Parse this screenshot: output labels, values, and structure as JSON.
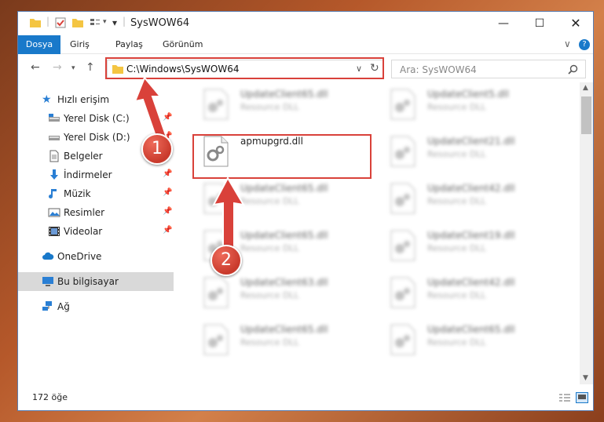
{
  "window": {
    "title": "SysWOW64"
  },
  "ribbon": {
    "tabs": [
      "Dosya",
      "Giriş",
      "Paylaş",
      "Görünüm"
    ]
  },
  "address": {
    "path": "C:\\Windows\\SysWOW64"
  },
  "search": {
    "placeholder": "Ara: SysWOW64"
  },
  "sidebar": {
    "quick_access": "Hızlı erişim",
    "items": [
      {
        "label": "Yerel Disk (C:)",
        "icon": "drive-icon"
      },
      {
        "label": "Yerel Disk (D:)",
        "icon": "drive-icon"
      },
      {
        "label": "Belgeler",
        "icon": "documents-icon"
      },
      {
        "label": "İndirmeler",
        "icon": "downloads-icon"
      },
      {
        "label": "Müzik",
        "icon": "music-icon"
      },
      {
        "label": "Resimler",
        "icon": "pictures-icon"
      },
      {
        "label": "Videolar",
        "icon": "videos-icon"
      }
    ],
    "onedrive": "OneDrive",
    "this_pc": "Bu bilgisayar",
    "network": "Ağ"
  },
  "files": {
    "left": [
      {
        "name": "UpdateClient65.dll",
        "type": "Resource DLL"
      },
      {
        "name": "apmupgrd.dll",
        "type": ""
      },
      {
        "name": "UpdateClient65.dll",
        "type": "Resource DLL"
      },
      {
        "name": "UpdateClient65.dll",
        "type": "Resource DLL"
      },
      {
        "name": "UpdateClient63.dll",
        "type": "Resource DLL"
      },
      {
        "name": "UpdateClient65.dll",
        "type": "Resource DLL"
      }
    ],
    "right": [
      {
        "name": "UpdateClient5.dll",
        "type": "Resource DLL"
      },
      {
        "name": "UpdateClient21.dll",
        "type": "Resource DLL"
      },
      {
        "name": "UpdateClient42.dll",
        "type": "Resource DLL"
      },
      {
        "name": "UpdateClient19.dll",
        "type": "Resource DLL"
      },
      {
        "name": "UpdateClient42.dll",
        "type": "Resource DLL"
      },
      {
        "name": "UpdateClient65.dll",
        "type": "Resource DLL"
      }
    ]
  },
  "status": {
    "count": "172 öğe"
  },
  "markers": [
    "1",
    "2"
  ],
  "colors": {
    "accent": "#1979ca",
    "highlight": "#d9413a"
  }
}
